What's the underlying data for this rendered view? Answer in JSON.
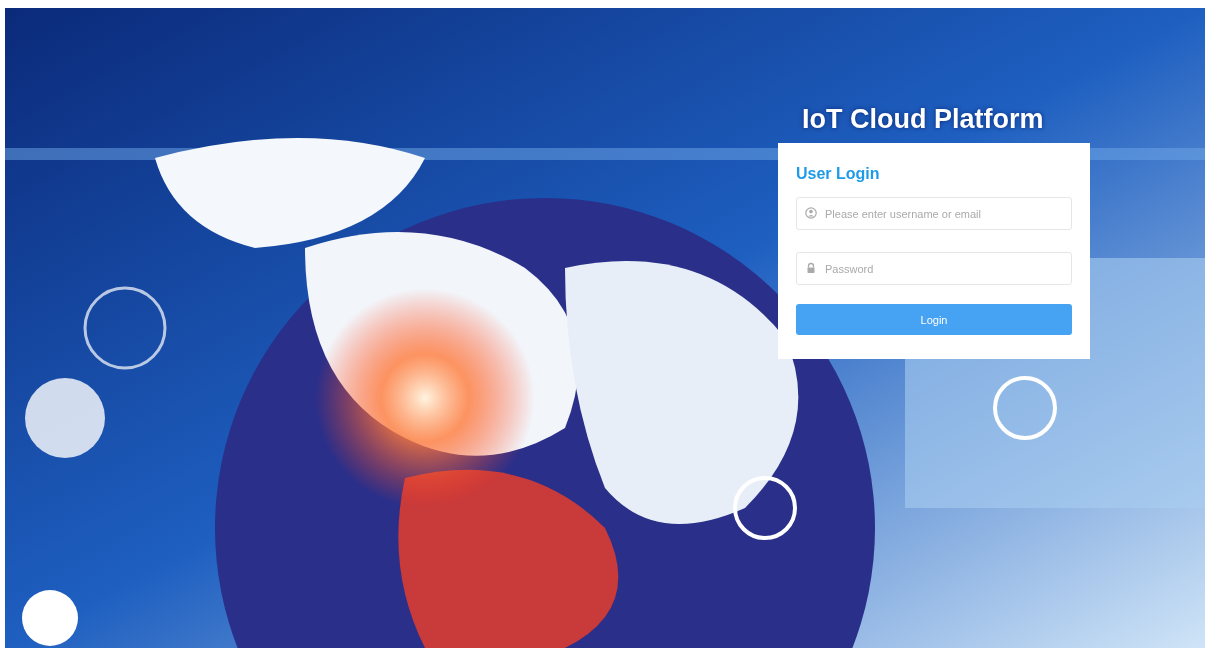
{
  "title": "IoT Cloud Platform",
  "login": {
    "heading": "User Login",
    "username": {
      "placeholder": "Please enter username or email"
    },
    "password": {
      "placeholder": "Password"
    },
    "button": "Login"
  }
}
